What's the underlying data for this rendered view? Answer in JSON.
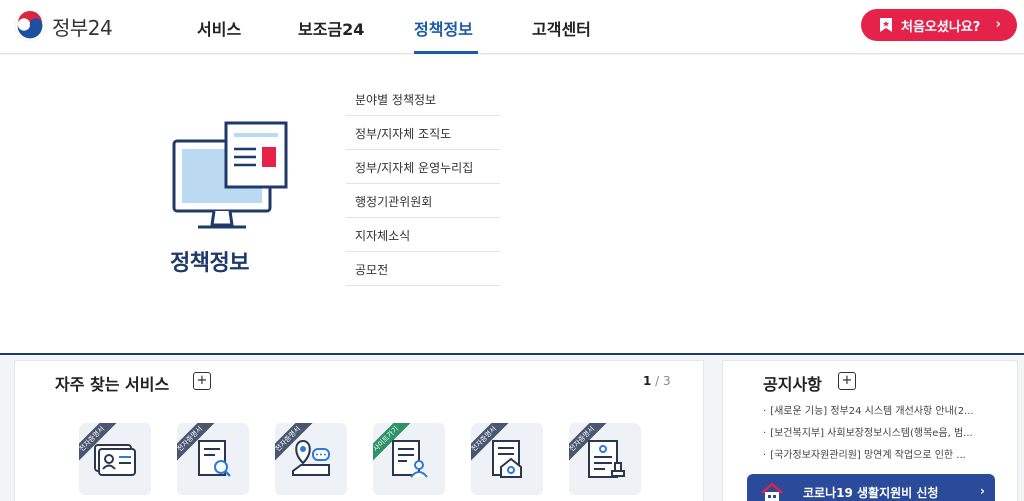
{
  "header": {
    "logo_text": "정부24",
    "nav": [
      {
        "label": "서비스"
      },
      {
        "label": "보조금24"
      },
      {
        "label": "정책정보"
      },
      {
        "label": "고객센터"
      }
    ],
    "first_visit_label": "처음오셨나요?",
    "first_visit_chevron": "›"
  },
  "mega": {
    "title": "정책정보",
    "items": [
      "분야별 정책정보",
      "정부/지자체 조직도",
      "정부/지자체 운영누리집",
      "행정기관위원회",
      "지자체소식",
      "공모전"
    ]
  },
  "services": {
    "title": "자주 찾는 서비스",
    "plus": "+",
    "page_current": "1",
    "page_sep": " / ",
    "page_total": "3",
    "tiles": [
      {
        "badge": "전자증명서",
        "icon": "id-card-icon"
      },
      {
        "badge": "전자증명서",
        "icon": "document-search-icon"
      },
      {
        "badge": "전자증명서",
        "icon": "location-chat-icon"
      },
      {
        "badge": "사이트가기",
        "icon": "person-document-icon"
      },
      {
        "badge": "전자증명서",
        "icon": "house-document-icon"
      },
      {
        "badge": "전자증명서",
        "icon": "certificate-stamp-icon"
      }
    ]
  },
  "notice": {
    "title": "공지사항",
    "plus": "+",
    "items": [
      "[새로운 기능] 정부24 시스템 개선사항 안내(2...",
      "[보건복지부] 사회보장정보시스템(행복e음, 범...",
      "[국가정보자원관리원] 망연계 작업으로 인한 ..."
    ],
    "covid_label": "코로나19 생활지원비 신청",
    "covid_chevron": "›"
  },
  "colors": {
    "primary_blue": "#1a5aa8",
    "navy": "#1e3a6a",
    "accent_red": "#e5224a",
    "covid_blue": "#2c4a9a"
  }
}
